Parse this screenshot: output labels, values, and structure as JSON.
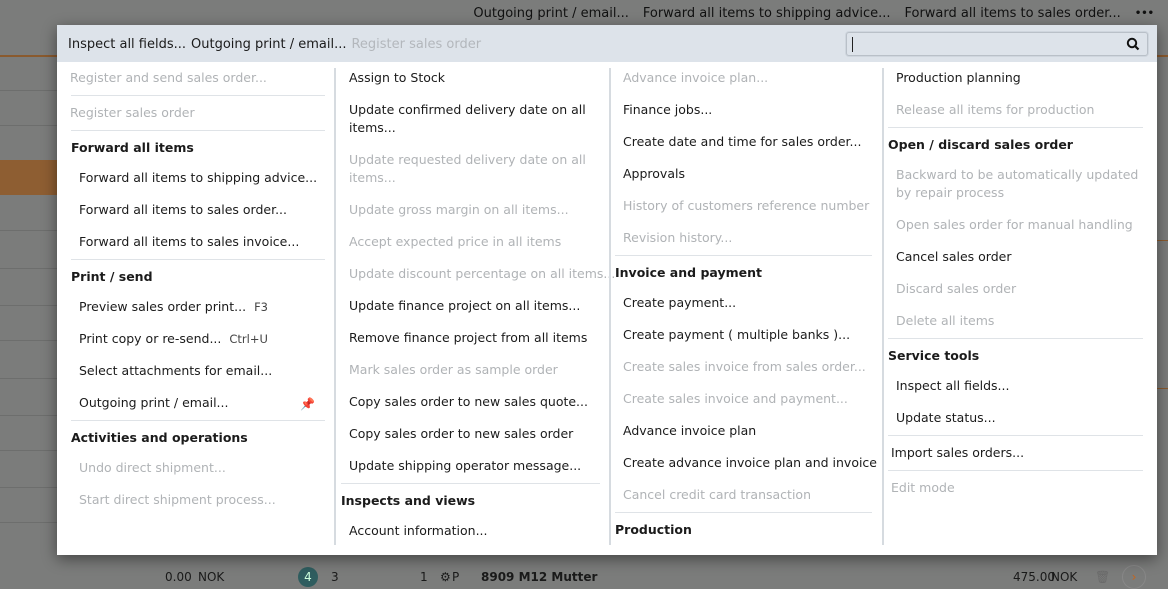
{
  "toolbar_links": [
    "Outgoing print / email...",
    "Forward all items to shipping advice...",
    "Forward all items to sales order..."
  ],
  "more_icon": "•••",
  "favorites": [
    {
      "label": "Inspect all fields...",
      "disabled": false
    },
    {
      "label": "Outgoing print / email...",
      "disabled": false
    },
    {
      "label": "Register sales order",
      "disabled": true
    }
  ],
  "search": {
    "value": "",
    "placeholder": ""
  },
  "columns": [
    [
      {
        "t": "item",
        "label": "Register and send sales order...",
        "disabled": true
      },
      {
        "t": "div"
      },
      {
        "t": "item",
        "label": "Register sales order",
        "disabled": true
      },
      {
        "t": "div"
      },
      {
        "t": "head",
        "label": "Forward all items"
      },
      {
        "t": "item",
        "label": "Forward all items to shipping advice...",
        "sub": true
      },
      {
        "t": "item",
        "label": "Forward all items to sales order...",
        "sub": true
      },
      {
        "t": "item",
        "label": "Forward all items to sales invoice...",
        "sub": true
      },
      {
        "t": "div"
      },
      {
        "t": "head",
        "label": "Print / send"
      },
      {
        "t": "item",
        "label": "Preview sales order print...",
        "sub": true,
        "shortcut": "F3"
      },
      {
        "t": "item",
        "label": "Print copy or re-send...",
        "sub": true,
        "shortcut": "Ctrl+U"
      },
      {
        "t": "item",
        "label": "Select attachments for email...",
        "sub": true
      },
      {
        "t": "item",
        "label": "Outgoing print / email...",
        "sub": true,
        "pinned": true
      },
      {
        "t": "div"
      },
      {
        "t": "head",
        "label": "Activities and operations"
      },
      {
        "t": "item",
        "label": "Undo direct shipment...",
        "sub": true,
        "disabled": true
      },
      {
        "t": "item",
        "label": "Start direct shipment process...",
        "sub": true,
        "disabled": true
      }
    ],
    [
      {
        "t": "item",
        "label": "Assign to Stock",
        "sub": true
      },
      {
        "t": "item",
        "label": "Update confirmed delivery date on all items...",
        "sub": true,
        "wrap": true
      },
      {
        "t": "item",
        "label": "Update requested delivery date on all items...",
        "sub": true,
        "wrap": true,
        "disabled": true
      },
      {
        "t": "item",
        "label": "Update gross margin on all items...",
        "sub": true,
        "disabled": true
      },
      {
        "t": "item",
        "label": "Accept expected price in all items",
        "sub": true,
        "disabled": true
      },
      {
        "t": "item",
        "label": "Update discount percentage on all items...",
        "sub": true,
        "disabled": true
      },
      {
        "t": "item",
        "label": "Update finance project on all items...",
        "sub": true
      },
      {
        "t": "item",
        "label": "Remove finance project from all items",
        "sub": true
      },
      {
        "t": "item",
        "label": "Mark sales order as sample order",
        "sub": true,
        "disabled": true
      },
      {
        "t": "item",
        "label": "Copy sales order to new sales quote...",
        "sub": true
      },
      {
        "t": "item",
        "label": "Copy sales order to new sales order",
        "sub": true
      },
      {
        "t": "item",
        "label": "Update shipping operator message...",
        "sub": true
      },
      {
        "t": "div"
      },
      {
        "t": "head",
        "label": "Inspects and views"
      },
      {
        "t": "item",
        "label": "Account information...",
        "sub": true
      }
    ],
    [
      {
        "t": "item",
        "label": "Advance invoice plan...",
        "sub": true,
        "disabled": true
      },
      {
        "t": "item",
        "label": "Finance jobs...",
        "sub": true
      },
      {
        "t": "item",
        "label": "Create date and time for sales order...",
        "sub": true
      },
      {
        "t": "item",
        "label": "Approvals",
        "sub": true
      },
      {
        "t": "item",
        "label": "History of customers reference number",
        "sub": true,
        "disabled": true
      },
      {
        "t": "item",
        "label": "Revision history...",
        "sub": true,
        "disabled": true
      },
      {
        "t": "div"
      },
      {
        "t": "head",
        "label": "Invoice and payment"
      },
      {
        "t": "item",
        "label": "Create payment...",
        "sub": true
      },
      {
        "t": "item",
        "label": "Create payment ( multiple banks )...",
        "sub": true
      },
      {
        "t": "item",
        "label": "Create sales invoice from sales order...",
        "sub": true,
        "disabled": true
      },
      {
        "t": "item",
        "label": "Create sales invoice and payment...",
        "sub": true,
        "disabled": true
      },
      {
        "t": "item",
        "label": "Advance invoice plan",
        "sub": true
      },
      {
        "t": "item",
        "label": "Create advance invoice plan and invoice",
        "sub": true
      },
      {
        "t": "item",
        "label": "Cancel credit card transaction",
        "sub": true,
        "disabled": true
      },
      {
        "t": "div"
      },
      {
        "t": "head",
        "label": "Production"
      }
    ],
    [
      {
        "t": "item",
        "label": "Production planning",
        "sub": true
      },
      {
        "t": "item",
        "label": "Release all items for production",
        "sub": true,
        "disabled": true
      },
      {
        "t": "div"
      },
      {
        "t": "head",
        "label": "Open / discard sales order"
      },
      {
        "t": "item",
        "label": "Backward to be automatically updated by repair process",
        "sub": true,
        "wrap": true,
        "disabled": true
      },
      {
        "t": "item",
        "label": "Open sales order for manual handling",
        "sub": true,
        "disabled": true
      },
      {
        "t": "item",
        "label": "Cancel sales order",
        "sub": true
      },
      {
        "t": "item",
        "label": "Discard sales order",
        "sub": true,
        "disabled": true
      },
      {
        "t": "item",
        "label": "Delete all items",
        "sub": true,
        "disabled": true
      },
      {
        "t": "div"
      },
      {
        "t": "head",
        "label": "Service tools"
      },
      {
        "t": "item",
        "label": "Inspect all fields...",
        "sub": true
      },
      {
        "t": "item",
        "label": "Update status...",
        "sub": true
      },
      {
        "t": "div"
      },
      {
        "t": "item",
        "label": "Import sales orders...",
        "top": true
      },
      {
        "t": "div"
      },
      {
        "t": "item",
        "label": "Edit mode",
        "top": true,
        "disabled": true
      }
    ]
  ],
  "background_row": {
    "left_amount": "0.00",
    "left_currency": "NOK",
    "badge": "4",
    "qty": "3",
    "line": "1",
    "type": "P",
    "item": "8909 M12 Mutter",
    "amount": "475.00",
    "currency": "NOK"
  },
  "colors": {
    "accent": "#c8641a",
    "header_bg": "#dde3ea",
    "disabled": "#b0b3b6",
    "overlay": "#7b7c7b"
  }
}
